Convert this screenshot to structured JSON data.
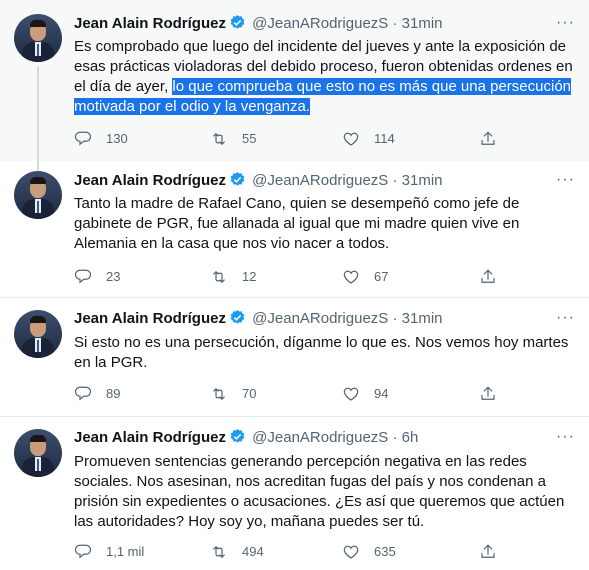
{
  "tweets": [
    {
      "name": "Jean Alain Rodríguez",
      "handle": "@JeanARodriguezS",
      "dot": "·",
      "time": "31min",
      "text_pre": "Es comprobado que luego del incidente del jueves y ante la exposición de esas prácticas violadoras del debido proceso, fueron obtenidas ordenes en el día de ayer, ",
      "text_hl": "lo que comprueba que esto no es más que una persecución motivada por el odio y la venganza.",
      "reply": "130",
      "retweet": "55",
      "like": "114"
    },
    {
      "name": "Jean Alain Rodríguez",
      "handle": "@JeanARodriguezS",
      "dot": "·",
      "time": "31min",
      "text": "Tanto la madre de Rafael Cano, quien se desempeñó como jefe de gabinete de PGR, fue allanada al igual que mi madre quien vive en Alemania en la casa que nos vio nacer a todos.",
      "reply": "23",
      "retweet": "12",
      "like": "67"
    },
    {
      "name": "Jean Alain Rodríguez",
      "handle": "@JeanARodriguezS",
      "dot": "·",
      "time": "31min",
      "text": "Si esto no es una persecución, díganme lo que es. Nos vemos hoy martes en la PGR.",
      "reply": "89",
      "retweet": "70",
      "like": "94"
    },
    {
      "name": "Jean Alain Rodríguez",
      "handle": "@JeanARodriguezS",
      "dot": "·",
      "time": "6h",
      "text": "Promueven sentencias generando percepción negativa en las redes sociales. Nos asesinan, nos acreditan fugas del país y nos condenan a prisión sin expedientes o acusaciones. ¿Es así que queremos que actúen las autoridades? Hoy soy yo, mañana puedes ser tú.",
      "reply": "1,1 mil",
      "retweet": "494",
      "like": "635"
    }
  ],
  "icons": {
    "more": "more-icon",
    "reply": "reply-icon",
    "retweet": "retweet-icon",
    "like": "heart-icon",
    "share": "share-icon",
    "verified": "verified-badge-icon"
  },
  "colors": {
    "verified": "#1d9bf0",
    "highlight": "#1a73e8",
    "muted": "#536471"
  }
}
